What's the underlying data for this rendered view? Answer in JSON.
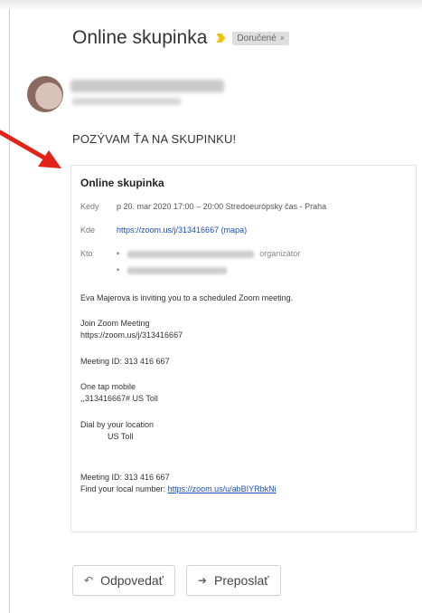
{
  "email": {
    "subject": "Online skupinka",
    "label_chip": "Doručené",
    "label_close": "×",
    "invite_heading": "POZÝVAM ŤA NA SKUPINKU!"
  },
  "card": {
    "title": "Online skupinka",
    "when_key": "Kedy",
    "when_value": "p 20. mar 2020 17:00 – 20:00 Stredoeurópsky čas - Praha",
    "where_key": "Kde",
    "where_link": "https://zoom.us/j/313416667",
    "where_maps": "(mapa)",
    "who_key": "Kto",
    "who_suffix": "organizátor",
    "bullet": "•",
    "body": [
      "Eva Majerova is inviting you to a scheduled Zoom meeting.",
      "Join Zoom Meeting",
      "https://zoom.us/j/313416667",
      "Meeting ID: 313 416 667",
      "One tap mobile",
      ",,313416667# US Toll",
      "Dial by your location",
      "US Toll",
      "Meeting ID: 313 416 667",
      "Find your local number:",
      "https://zoom.us/u/abBIYRbkNi"
    ]
  },
  "actions": {
    "reply_label": "Odpovedať",
    "reply_icon": "reply-icon",
    "forward_label": "Preposlať",
    "forward_icon": "forward-icon"
  },
  "colors": {
    "arrow": "#e2231a",
    "link": "#1a4fb5",
    "important": "#f4c20d"
  }
}
